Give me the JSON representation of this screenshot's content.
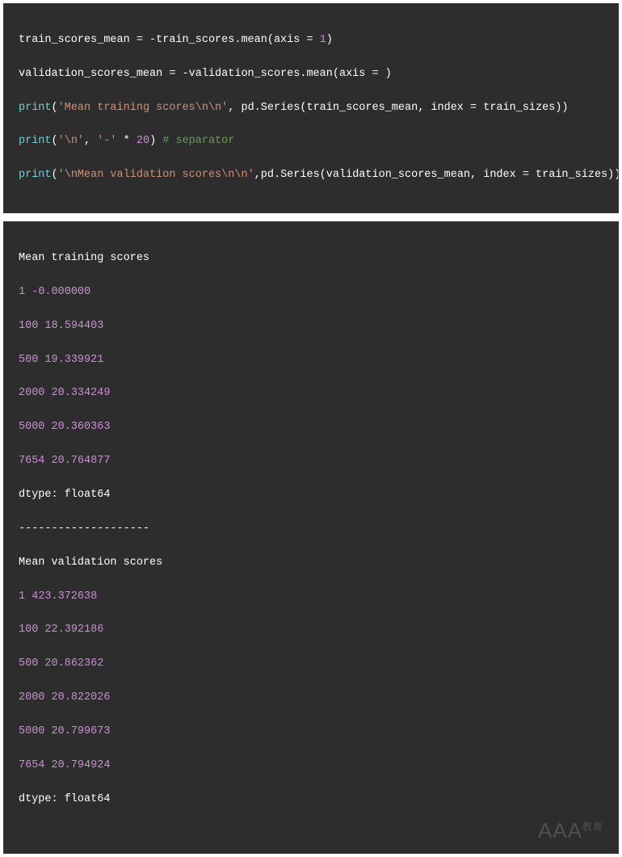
{
  "code": {
    "l1": {
      "a": "train_scores_mean = -train_scores.mean(axis = ",
      "n": "1",
      "b": ")"
    },
    "l2": {
      "a": "validation_scores_mean = -validation_scores.mean(axis = )"
    },
    "l3": {
      "fn": "print",
      "a": "(",
      "s1": "'Mean training scores\\n\\n'",
      "b": ", pd.Series(train_scores_mean, index = train_sizes))"
    },
    "l4": {
      "fn": "print",
      "a": "(",
      "s1": "'\\n'",
      "b": ", ",
      "s2": "'-'",
      "c": " * ",
      "n": "20",
      "d": ") ",
      "cm": "# separator"
    },
    "l5": {
      "fn": "print",
      "a": "(",
      "s1": "'\\nMean validation scores\\n\\n'",
      "b": ",pd.Series(validation_scores_mean, index = train_sizes))"
    }
  },
  "output": {
    "h1": "Mean training scores",
    "train": [
      {
        "k": "1",
        "v": "-0.000000"
      },
      {
        "k": "100",
        "v": "18.594403"
      },
      {
        "k": "500",
        "v": "19.339921"
      },
      {
        "k": "2000",
        "v": "20.334249"
      },
      {
        "k": "5000",
        "v": "20.360363"
      },
      {
        "k": "7654",
        "v": "20.764877"
      }
    ],
    "dtype": "dtype: float64",
    "sep": "--------------------",
    "h2": "Mean validation scores",
    "valid": [
      {
        "k": "1",
        "v": "423.372638"
      },
      {
        "k": "100",
        "v": "22.392186"
      },
      {
        "k": "500",
        "v": "20.862362"
      },
      {
        "k": "2000",
        "v": "20.822026"
      },
      {
        "k": "5000",
        "v": "20.799673"
      },
      {
        "k": "7654",
        "v": "20.794924"
      }
    ]
  },
  "watermark": {
    "main": "AAA",
    "sub": "教育"
  }
}
